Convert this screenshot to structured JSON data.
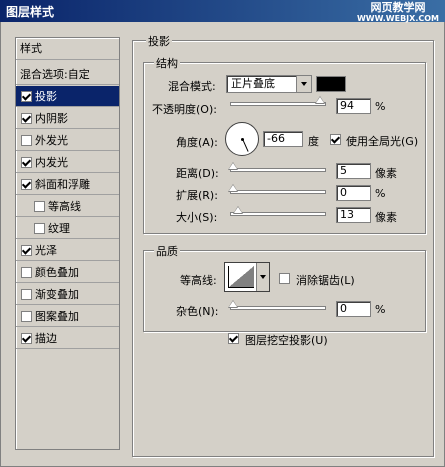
{
  "window": {
    "title": "图层样式",
    "watermark_line1": "网页教学网",
    "watermark_line2": "WWW.WEBJX.COM"
  },
  "sidebar": {
    "header": "样式",
    "blend_options": "混合选项:自定",
    "items": [
      {
        "label": "投影",
        "checked": true,
        "selected": true
      },
      {
        "label": "内阴影",
        "checked": true
      },
      {
        "label": "外发光",
        "checked": false
      },
      {
        "label": "内发光",
        "checked": true
      },
      {
        "label": "斜面和浮雕",
        "checked": true
      },
      {
        "label": "等高线",
        "checked": false
      },
      {
        "label": "纹理",
        "checked": false
      },
      {
        "label": "光泽",
        "checked": true
      },
      {
        "label": "颜色叠加",
        "checked": false
      },
      {
        "label": "渐变叠加",
        "checked": false
      },
      {
        "label": "图案叠加",
        "checked": false
      },
      {
        "label": "描边",
        "checked": true
      }
    ]
  },
  "panel": {
    "title": "投影",
    "structure": {
      "title": "结构",
      "blend_mode_label": "混合模式:",
      "blend_mode_value": "正片叠底",
      "swatch_color": "#000000",
      "opacity_label": "不透明度(O):",
      "opacity_value": "94",
      "opacity_unit": "%",
      "angle_label": "角度(A):",
      "angle_value": "-66",
      "angle_unit": "度",
      "global_light_label": "使用全局光(G)",
      "global_light_checked": true,
      "distance_label": "距离(D):",
      "distance_value": "5",
      "distance_unit": "像素",
      "spread_label": "扩展(R):",
      "spread_value": "0",
      "spread_unit": "%",
      "size_label": "大小(S):",
      "size_value": "13",
      "size_unit": "像素"
    },
    "quality": {
      "title": "品质",
      "contour_label": "等高线:",
      "antialias_label": "消除锯齿(L)",
      "antialias_checked": false,
      "noise_label": "杂色(N):",
      "noise_value": "0",
      "noise_unit": "%"
    },
    "knockout_label": "图层挖空投影(U)",
    "knockout_checked": true
  }
}
